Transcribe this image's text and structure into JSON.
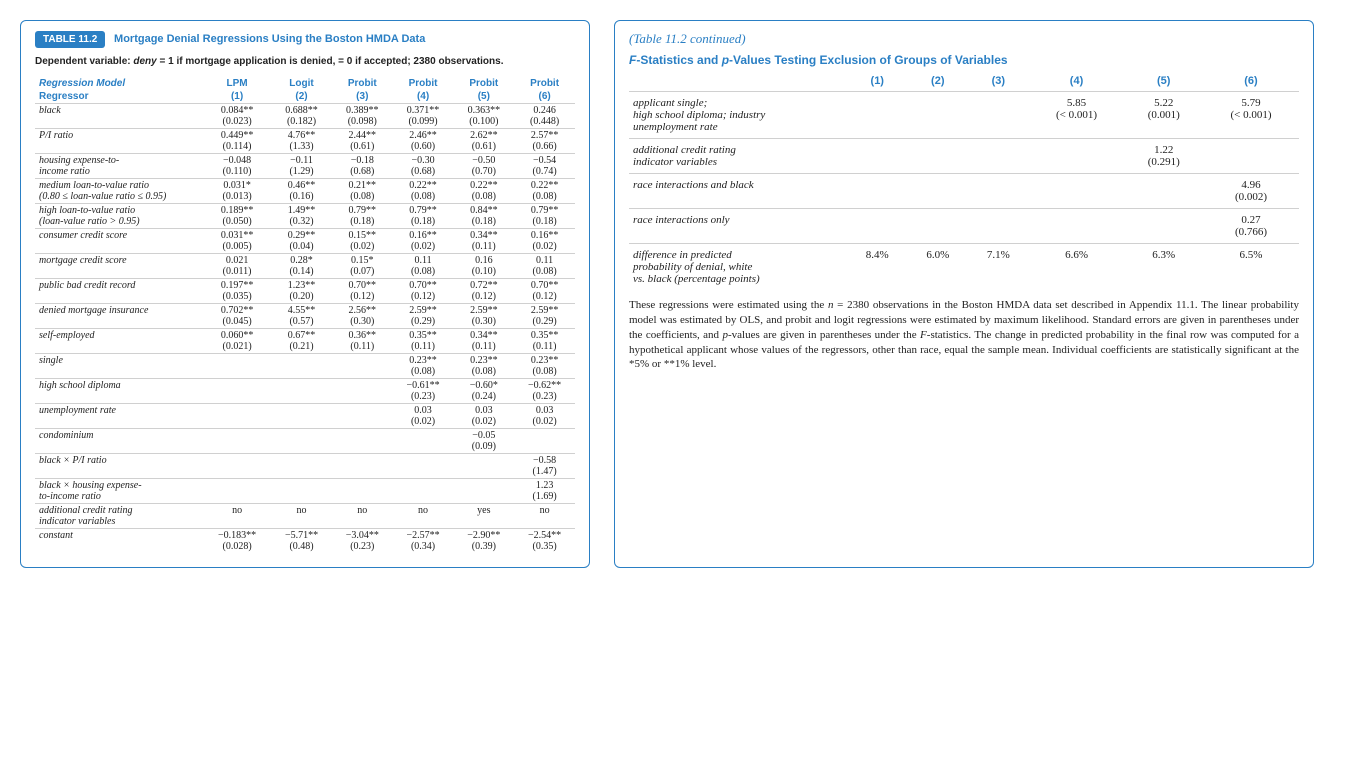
{
  "left": {
    "tag": "TABLE 11.2",
    "title": "Mortgage Denial Regressions Using the Boston HMDA Data",
    "depvar_html": "Dependent variable: <i>deny</i> = 1 if mortgage application is denied, = 0 if accepted; 2380 observations.",
    "model_heads": [
      "Regression Model",
      "LPM",
      "Logit",
      "Probit",
      "Probit",
      "Probit",
      "Probit"
    ],
    "col_heads": [
      "Regressor",
      "(1)",
      "(2)",
      "(3)",
      "(4)",
      "(5)",
      "(6)"
    ],
    "rows": [
      {
        "label": "black",
        "c": [
          "0.084**",
          "0.688**",
          "0.389**",
          "0.371**",
          "0.363**",
          "0.246"
        ],
        "s": [
          "(0.023)",
          "(0.182)",
          "(0.098)",
          "(0.099)",
          "(0.100)",
          "(0.448)"
        ]
      },
      {
        "label": "P/I ratio",
        "c": [
          "0.449**",
          "4.76**",
          "2.44**",
          "2.46**",
          "2.62**",
          "2.57**"
        ],
        "s": [
          "(0.114)",
          "(1.33)",
          "(0.61)",
          "(0.60)",
          "(0.61)",
          "(0.66)"
        ]
      },
      {
        "label": "housing expense-to-\nincome ratio",
        "c": [
          "−0.048",
          "−0.11",
          "−0.18",
          "−0.30",
          "−0.50",
          "−0.54"
        ],
        "s": [
          "(0.110)",
          "(1.29)",
          "(0.68)",
          "(0.68)",
          "(0.70)",
          "(0.74)"
        ]
      },
      {
        "label": "medium loan-to-value ratio\n(0.80 ≤ loan-value ratio ≤ 0.95)",
        "c": [
          "0.031*",
          "0.46**",
          "0.21**",
          "0.22**",
          "0.22**",
          "0.22**"
        ],
        "s": [
          "(0.013)",
          "(0.16)",
          "(0.08)",
          "(0.08)",
          "(0.08)",
          "(0.08)"
        ]
      },
      {
        "label": "high loan-to-value ratio\n(loan-value ratio > 0.95)",
        "c": [
          "0.189**",
          "1.49**",
          "0.79**",
          "0.79**",
          "0.84**",
          "0.79**"
        ],
        "s": [
          "(0.050)",
          "(0.32)",
          "(0.18)",
          "(0.18)",
          "(0.18)",
          "(0.18)"
        ]
      },
      {
        "label": "consumer credit score",
        "c": [
          "0.031**",
          "0.29**",
          "0.15**",
          "0.16**",
          "0.34**",
          "0.16**"
        ],
        "s": [
          "(0.005)",
          "(0.04)",
          "(0.02)",
          "(0.02)",
          "(0.11)",
          "(0.02)"
        ]
      },
      {
        "label": "mortgage credit score",
        "c": [
          "0.021",
          "0.28*",
          "0.15*",
          "0.11",
          "0.16",
          "0.11"
        ],
        "s": [
          "(0.011)",
          "(0.14)",
          "(0.07)",
          "(0.08)",
          "(0.10)",
          "(0.08)"
        ]
      },
      {
        "label": "public bad credit record",
        "c": [
          "0.197**",
          "1.23**",
          "0.70**",
          "0.70**",
          "0.72**",
          "0.70**"
        ],
        "s": [
          "(0.035)",
          "(0.20)",
          "(0.12)",
          "(0.12)",
          "(0.12)",
          "(0.12)"
        ]
      },
      {
        "label": "denied mortgage insurance",
        "c": [
          "0.702**",
          "4.55**",
          "2.56**",
          "2.59**",
          "2.59**",
          "2.59**"
        ],
        "s": [
          "(0.045)",
          "(0.57)",
          "(0.30)",
          "(0.29)",
          "(0.30)",
          "(0.29)"
        ]
      },
      {
        "label": "self-employed",
        "c": [
          "0.060**",
          "0.67**",
          "0.36**",
          "0.35**",
          "0.34**",
          "0.35**"
        ],
        "s": [
          "(0.021)",
          "(0.21)",
          "(0.11)",
          "(0.11)",
          "(0.11)",
          "(0.11)"
        ]
      },
      {
        "label": "single",
        "c": [
          "",
          "",
          "",
          "0.23**",
          "0.23**",
          "0.23**"
        ],
        "s": [
          "",
          "",
          "",
          "(0.08)",
          "(0.08)",
          "(0.08)"
        ]
      },
      {
        "label": "high school diploma",
        "c": [
          "",
          "",
          "",
          "−0.61**",
          "−0.60*",
          "−0.62**"
        ],
        "s": [
          "",
          "",
          "",
          "(0.23)",
          "(0.24)",
          "(0.23)"
        ]
      },
      {
        "label": "unemployment rate",
        "c": [
          "",
          "",
          "",
          "0.03",
          "0.03",
          "0.03"
        ],
        "s": [
          "",
          "",
          "",
          "(0.02)",
          "(0.02)",
          "(0.02)"
        ]
      },
      {
        "label": "condominium",
        "c": [
          "",
          "",
          "",
          "",
          "−0.05",
          ""
        ],
        "s": [
          "",
          "",
          "",
          "",
          "(0.09)",
          ""
        ]
      },
      {
        "label": "black × P/I ratio",
        "c": [
          "",
          "",
          "",
          "",
          "",
          "−0.58"
        ],
        "s": [
          "",
          "",
          "",
          "",
          "",
          "(1.47)"
        ]
      },
      {
        "label": "black × housing expense-\nto-income ratio",
        "c": [
          "",
          "",
          "",
          "",
          "",
          "1.23"
        ],
        "s": [
          "",
          "",
          "",
          "",
          "",
          "(1.69)"
        ]
      },
      {
        "label": "additional credit rating\nindicator variables",
        "c": [
          "no",
          "no",
          "no",
          "no",
          "yes",
          "no"
        ],
        "s": [
          "",
          "",
          "",
          "",
          "",
          ""
        ],
        "plain": true
      },
      {
        "label": "constant",
        "c": [
          "−0.183**",
          "−5.71**",
          "−3.04**",
          "−2.57**",
          "−2.90**",
          "−2.54**"
        ],
        "s": [
          "(0.028)",
          "(0.48)",
          "(0.23)",
          "(0.34)",
          "(0.39)",
          "(0.35)"
        ]
      }
    ]
  },
  "right": {
    "cont": "(Table 11.2 continued)",
    "ftitle_html": "<i>F</i>-Statistics and <i>p</i>-Values Testing Exclusion of Groups of Variables",
    "heads": [
      "(1)",
      "(2)",
      "(3)",
      "(4)",
      "(5)",
      "(6)"
    ],
    "rows": [
      {
        "label": "applicant single;\nhigh school diploma; industry\nunemployment rate",
        "v": [
          "",
          "",
          "",
          "5.85",
          "5.22",
          "5.79"
        ],
        "p": [
          "",
          "",
          "",
          "(< 0.001)",
          "(0.001)",
          "(< 0.001)"
        ]
      },
      {
        "label": "additional credit rating\nindicator variables",
        "v": [
          "",
          "",
          "",
          "",
          "1.22",
          ""
        ],
        "p": [
          "",
          "",
          "",
          "",
          "(0.291)",
          ""
        ]
      },
      {
        "label": "race interactions and black",
        "v": [
          "",
          "",
          "",
          "",
          "",
          "4.96"
        ],
        "p": [
          "",
          "",
          "",
          "",
          "",
          "(0.002)"
        ]
      },
      {
        "label": "race interactions only",
        "v": [
          "",
          "",
          "",
          "",
          "",
          "0.27"
        ],
        "p": [
          "",
          "",
          "",
          "",
          "",
          "(0.766)"
        ]
      },
      {
        "label": "difference in predicted\nprobability of denial, white\nvs. black (percentage points)",
        "v": [
          "8.4%",
          "6.0%",
          "7.1%",
          "6.6%",
          "6.3%",
          "6.5%"
        ],
        "p": [
          "",
          "",
          "",
          "",
          "",
          ""
        ]
      }
    ],
    "notes_html": "These regressions were estimated using the <i>n</i> = 2380 observations in the Boston HMDA data set described in Appendix 11.1. The linear probability model was estimated by OLS, and probit and logit regressions were estimated by maximum likelihood. Standard errors are given in parentheses under the coefficients, and <i>p</i>-values are given in parentheses under the <i>F</i>-statistics. The change in predicted probability in the final row was computed for a hypothetical applicant whose values of the regressors, other than race, equal the sample mean. Individual coefficients are statistically significant at the *5% or **1% level."
  }
}
